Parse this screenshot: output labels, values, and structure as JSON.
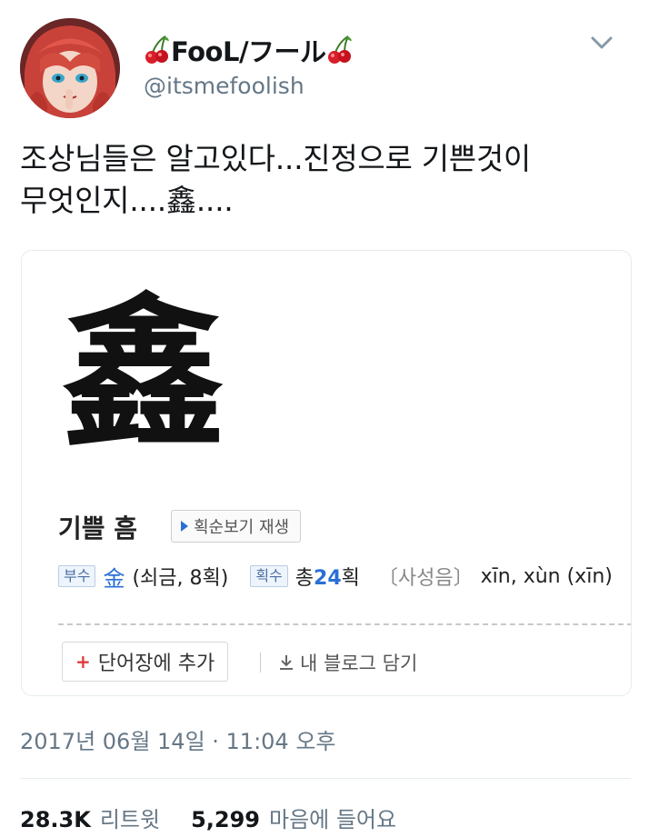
{
  "user": {
    "display_name": "FooL/フール",
    "handle": "@itsmefoolish"
  },
  "tweet": {
    "text": "조상님들은 알고있다...진정으로 기쁜것이\n무엇인지....鑫...."
  },
  "card": {
    "hanja": "鑫",
    "meaning": "기쁠 흠",
    "stroke_button": "획순보기 재생",
    "radical_tag": "부수",
    "radical_char": "金",
    "radical_desc": "(쇠금, 8획)",
    "strokes_tag": "획수",
    "strokes_prefix": "총",
    "strokes_num": "24",
    "strokes_suffix": "획",
    "pron_label": "〔사성음〕",
    "pron_value": "xīn, xùn (xīn)",
    "add_button": "단어장에 추가",
    "blog_button": "내 블로그 담기"
  },
  "meta": {
    "timestamp": "2017년 06월 14일 · 11:04 오후"
  },
  "stats": {
    "retweets_count": "28.3K",
    "retweets_label": "리트윗",
    "likes_count": "5,299",
    "likes_label": "마음에 들어요"
  },
  "icons": [
    "cherry-icon",
    "chevron-down-icon",
    "play-icon",
    "plus-icon",
    "download-icon"
  ],
  "colors": {
    "text_primary": "#14171a",
    "text_secondary": "#657786",
    "accent_blue": "#2a6fd6",
    "add_red": "#e03a3a"
  }
}
